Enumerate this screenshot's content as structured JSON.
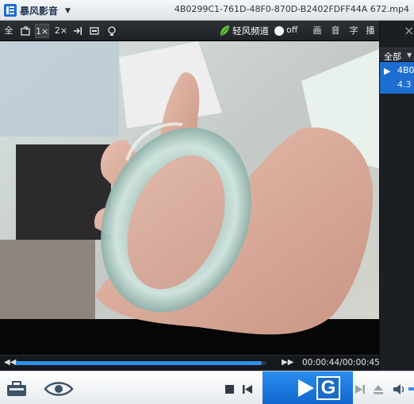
{
  "window": {
    "app_name": "暴风影音",
    "file_title": "4B0299C1-761D-48F0-870D-B2402FDFF44A  672.mp4"
  },
  "toolbar": {
    "fullscreen": "全",
    "size_1x": "1×",
    "size_2x": "2×",
    "light_channel_label": "轻风频道",
    "light_channel_state": "off",
    "picture": "画",
    "audio": "音",
    "subtitle": "字",
    "play_menu": "播"
  },
  "sidebar": {
    "filter_label": "全部",
    "item_name": "4B0",
    "item_size": "4.3"
  },
  "playback": {
    "elapsed": "00:00:44",
    "total": "00:00:45",
    "time_display": "00:00:44/00:00:45",
    "progress": 0.98
  },
  "logo_text": "G",
  "colors": {
    "accent": "#1e6dd1",
    "progress": "#2f8fe6",
    "light_channel_leaf": "#6cc43a"
  },
  "icons": [
    "app-logo-icon",
    "compact-mode-icon",
    "snap-icon",
    "fullscreen-icon",
    "bulb-icon",
    "leaf-icon",
    "toolbox-icon",
    "eye-icon",
    "stop-icon",
    "prev-icon",
    "play-icon",
    "next-icon",
    "eject-icon",
    "volume-icon",
    "sidebar-close-icon"
  ]
}
